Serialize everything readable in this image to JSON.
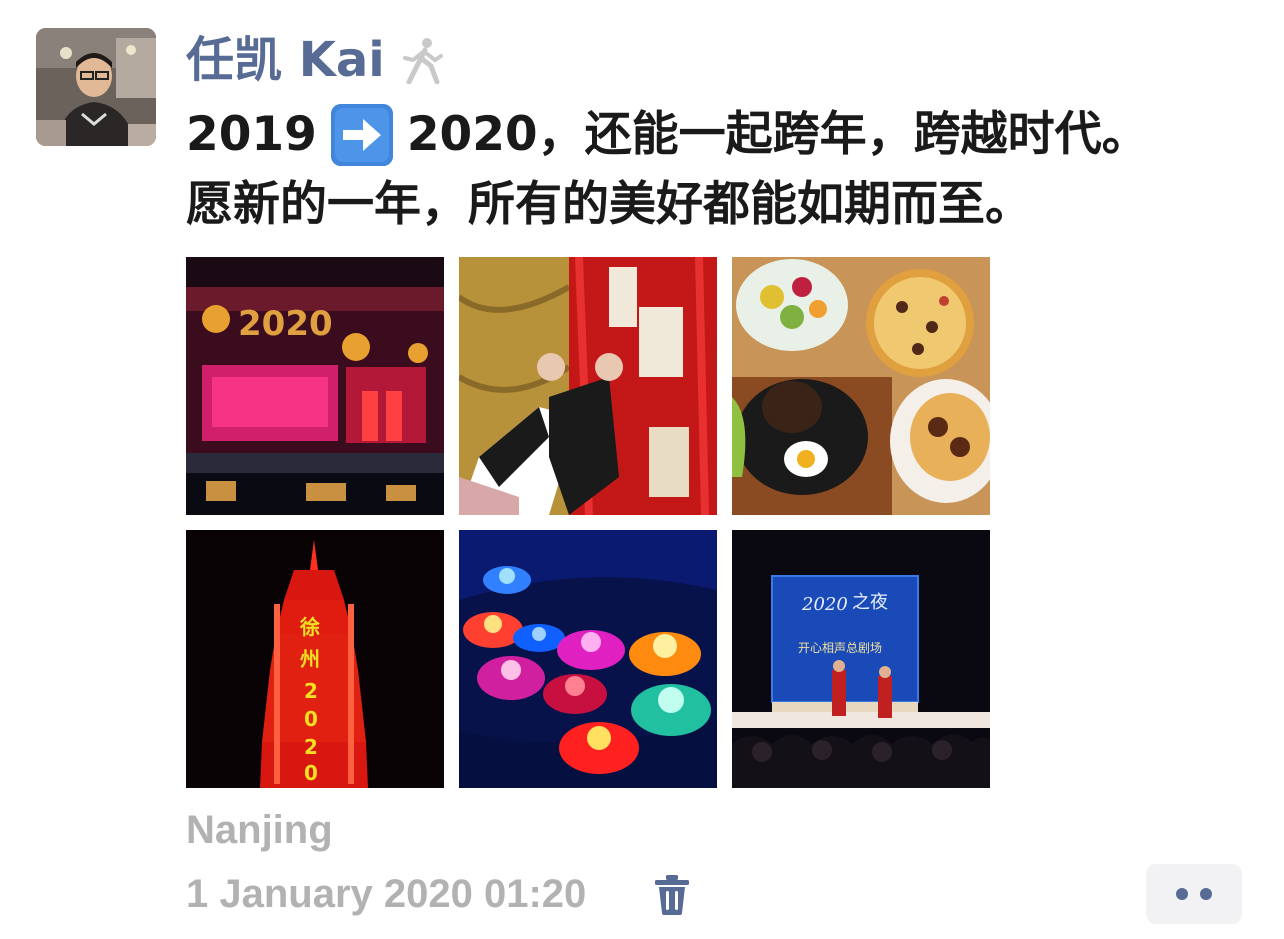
{
  "author": {
    "name": "任凯 Kai"
  },
  "post": {
    "text_line1_part1": "2019",
    "text_line1_part2": "2020，还能一起跨年，跨越时代。",
    "text_line2": "愿新的一年，所有的美好都能如期而至。"
  },
  "photos": [
    {
      "subject": "lancome-2020-building-night"
    },
    {
      "subject": "red-wish-tags"
    },
    {
      "subject": "steak-pizza-salad-meal"
    },
    {
      "subject": "red-lit-pagoda-2020"
    },
    {
      "subject": "lotus-lanterns-water"
    },
    {
      "subject": "stage-performance-2020"
    }
  ],
  "footer": {
    "location": "Nanjing",
    "timestamp": "1 January 2020 01:20"
  },
  "colors": {
    "link": "#576b95",
    "meta": "#b2b2b2",
    "text": "#1a1a1a"
  }
}
